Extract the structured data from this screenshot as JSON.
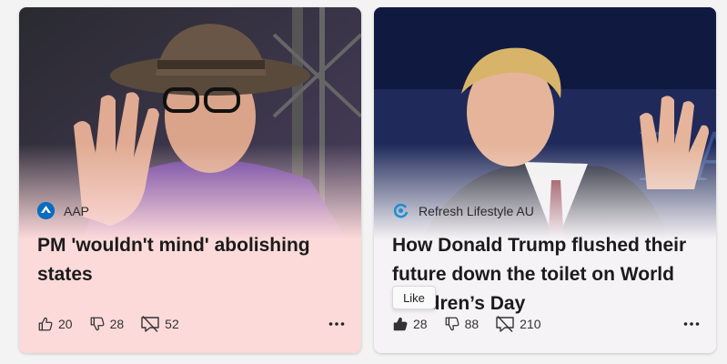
{
  "cards": [
    {
      "source": "AAP",
      "source_icon": "aap-logo-icon",
      "headline": "PM 'wouldn't mind' abolishing states",
      "likes": "20",
      "dislikes": "28",
      "comments": "52",
      "liked": false
    },
    {
      "source": "Refresh Lifestyle AU",
      "source_icon": "refresh-lifestyle-logo-icon",
      "headline": "How Donald Trump flushed their future down the toilet on World Children’s Day",
      "likes": "28",
      "dislikes": "88",
      "comments": "210",
      "liked": true
    }
  ],
  "tooltip": {
    "text": "Like"
  },
  "colors": {
    "card1_bg": "#fcdada",
    "card2_bg": "#f6f3f6",
    "text": "#1b1b1b"
  }
}
